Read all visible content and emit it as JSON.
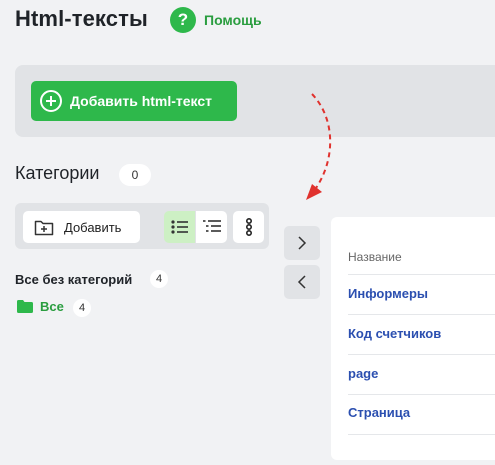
{
  "header": {
    "title": "Html-тексты",
    "help_label": "Помощь",
    "help_icon": "?"
  },
  "toolbar": {
    "add_button_label": "Добавить html-текст"
  },
  "categories": {
    "title": "Категории",
    "count": "0",
    "add_button_label": "Добавить",
    "uncategorized_label": "Все без категорий",
    "uncategorized_count": "4",
    "all_label": "Все",
    "all_count": "4"
  },
  "table": {
    "column_name": "Название",
    "rows": [
      {
        "name": "Информеры"
      },
      {
        "name": "Код счетчиков"
      },
      {
        "name": "page"
      },
      {
        "name": "Страница"
      }
    ]
  },
  "colors": {
    "accent_green": "#2eb84b",
    "link_blue": "#2b4fb0",
    "arrow_red": "#e0322e"
  }
}
